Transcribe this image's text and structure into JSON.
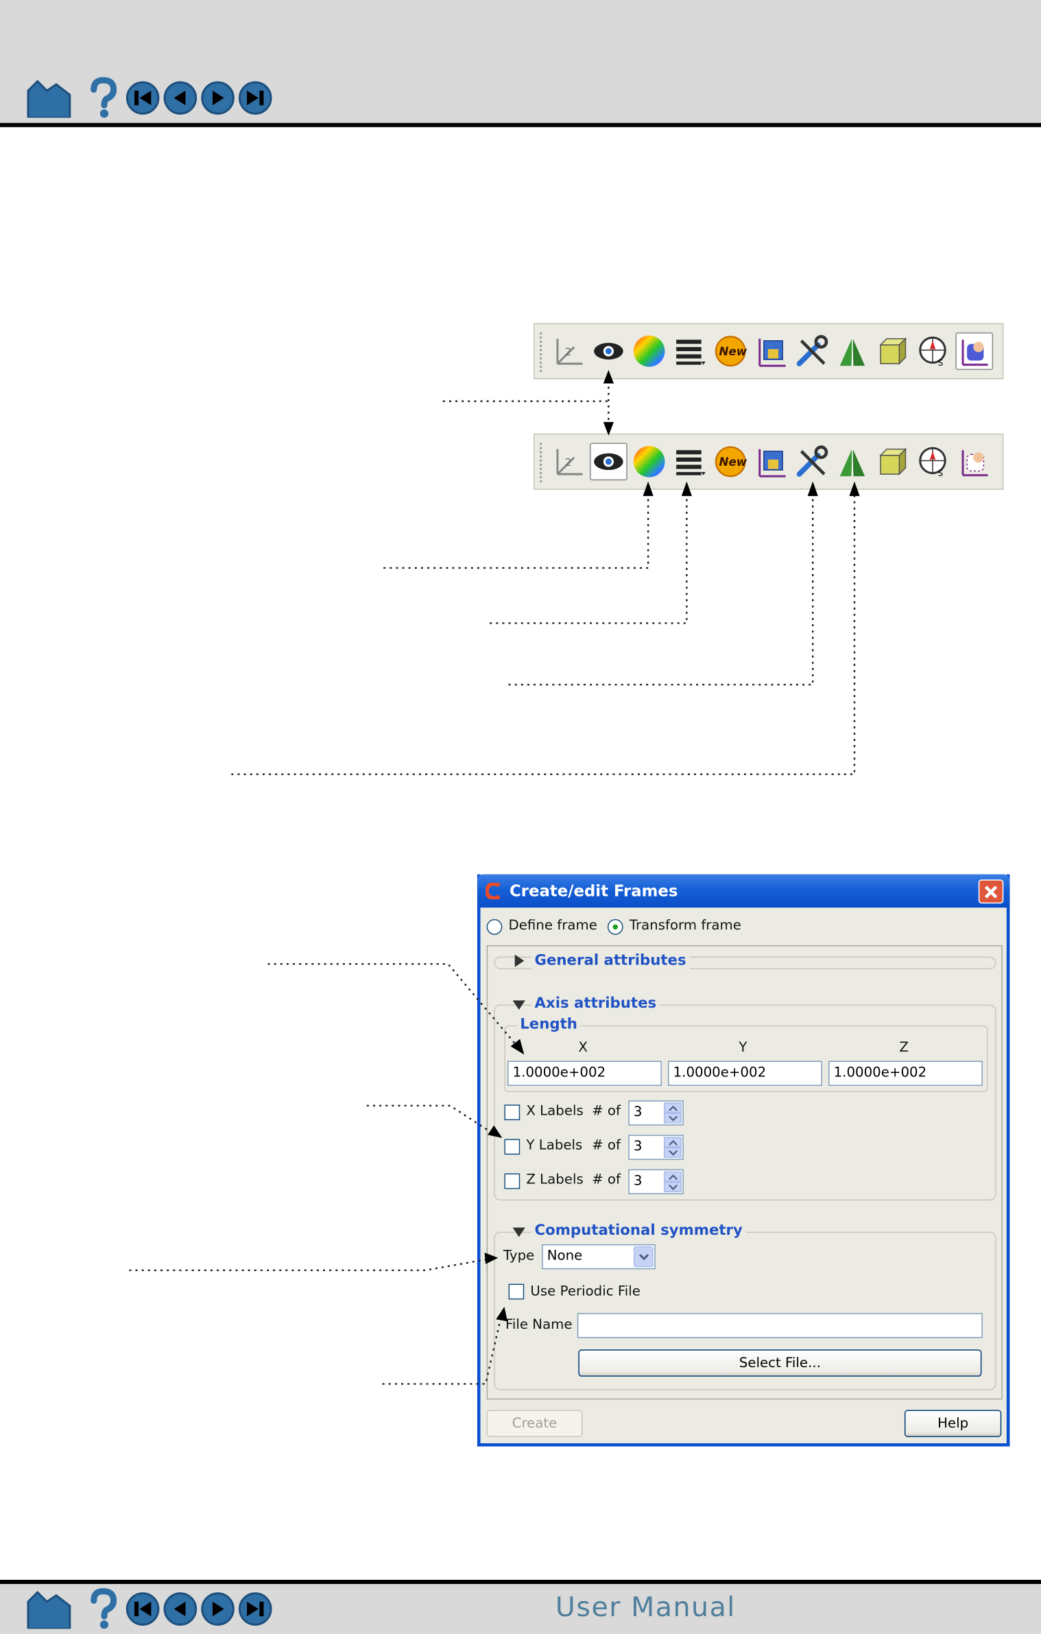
{
  "footer": {
    "manual_title": "User Manual"
  },
  "nav_icons": [
    "home-icon",
    "help-icon",
    "first-page-icon",
    "previous-page-icon",
    "next-page-icon",
    "last-page-icon"
  ],
  "toolbar_icons": [
    "axis-icon",
    "eye-icon",
    "color-wheel-icon",
    "menu-list-icon",
    "new-icon",
    "frame-lock-icon",
    "tools-icon",
    "symmetry-icon",
    "box-icon",
    "compass-icon",
    "select-icon"
  ],
  "dialog": {
    "title": "Create/edit Frames",
    "radio_define": "Define frame",
    "radio_transform": "Transform frame",
    "general_attributes": "General attributes",
    "axis_attributes": "Axis attributes",
    "length_label": "Length",
    "axis_labels": {
      "x": "X",
      "y": "Y",
      "z": "Z"
    },
    "length_values": {
      "x": "1.0000e+002",
      "y": "1.0000e+002",
      "z": "1.0000e+002"
    },
    "labels_rows": [
      {
        "label": "X Labels",
        "num_of": "# of",
        "value": "3"
      },
      {
        "label": "Y Labels",
        "num_of": "# of",
        "value": "3"
      },
      {
        "label": "Z Labels",
        "num_of": "# of",
        "value": "3"
      }
    ],
    "computational_symmetry": "Computational symmetry",
    "type_label": "Type",
    "type_value": "None",
    "use_periodic_file": "Use Periodic File",
    "file_name_label": "File Name",
    "file_name_value": "",
    "select_file_button": "Select File...",
    "create_button": "Create",
    "help_button": "Help"
  },
  "colors": {
    "title_bar": "#1660d6",
    "section_header": "#2153c5",
    "nav_blue": "#2e6fa6",
    "band_gray": "#d9d9d9"
  }
}
